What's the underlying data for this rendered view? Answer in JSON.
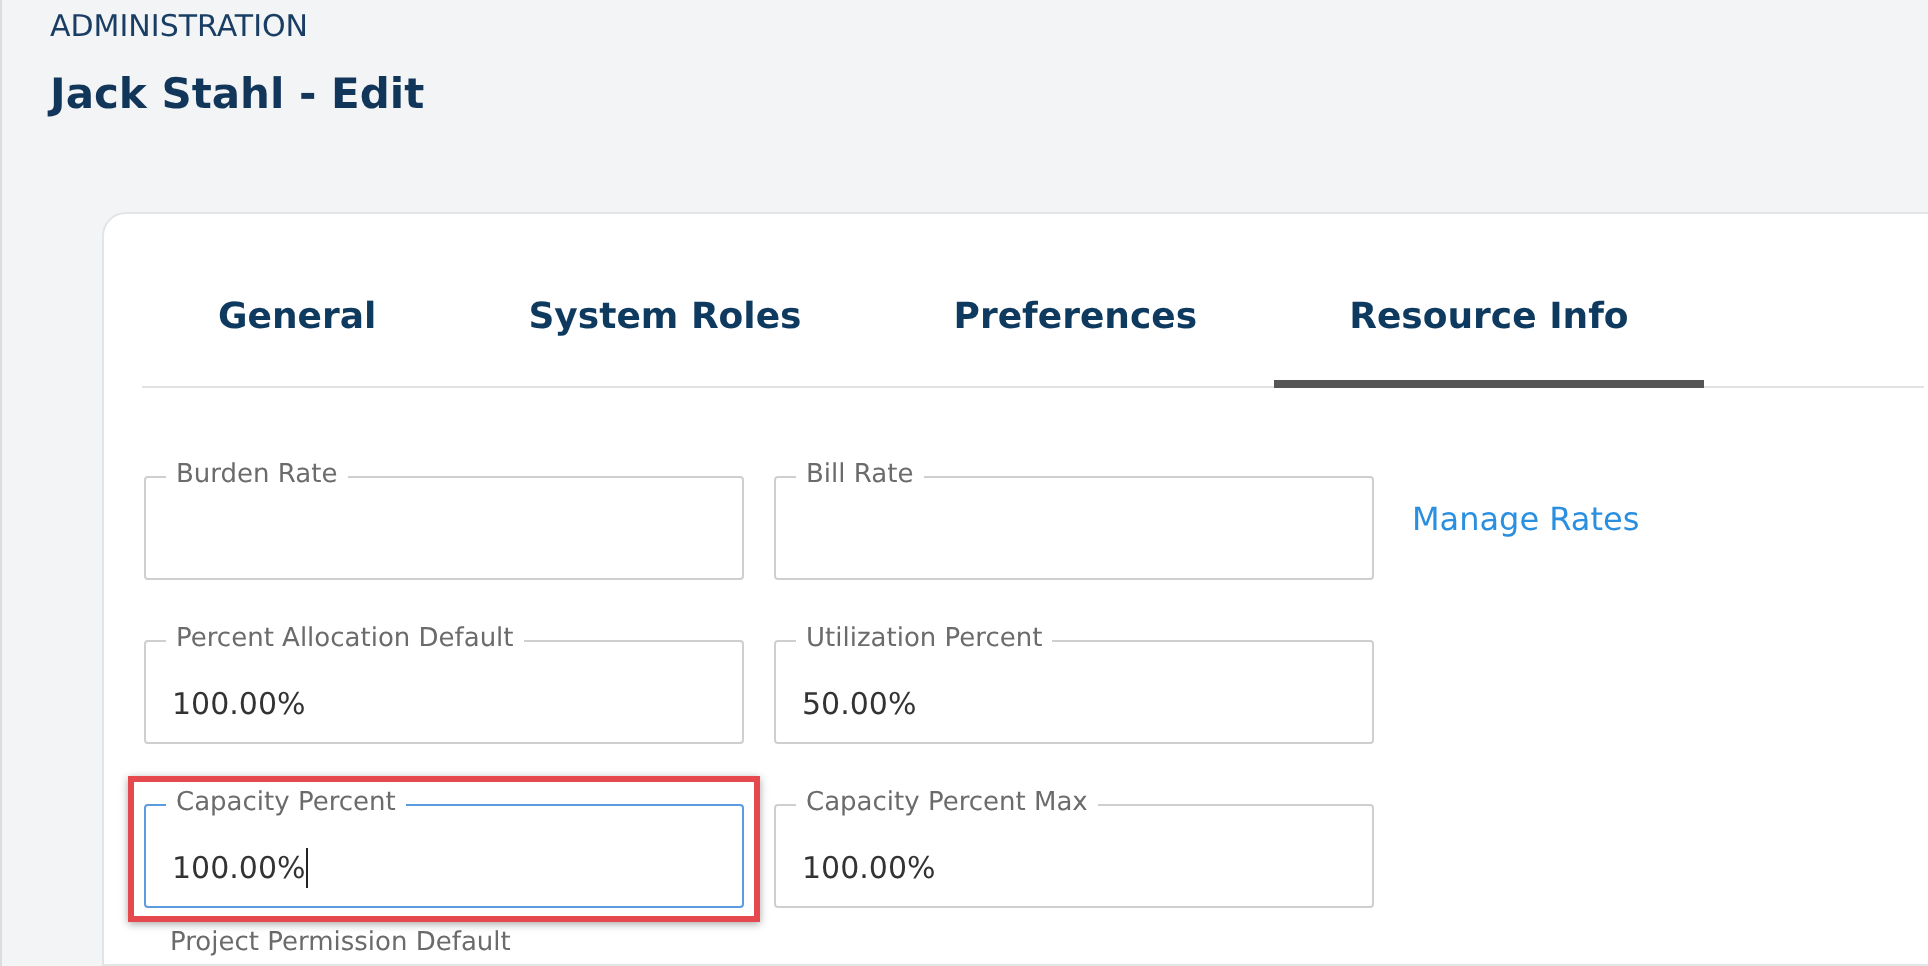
{
  "header": {
    "section": "ADMINISTRATION",
    "title": "Jack Stahl - Edit"
  },
  "tabs": [
    {
      "label": "General",
      "selected": false
    },
    {
      "label": "System Roles",
      "selected": false
    },
    {
      "label": "Preferences",
      "selected": false
    },
    {
      "label": "Resource Info",
      "selected": true
    }
  ],
  "form_rows": [
    [
      {
        "kind": "field",
        "label": "Burden Rate",
        "focused": false,
        "highlighted": false
      },
      {
        "kind": "field",
        "label": "Bill Rate",
        "focused": false,
        "highlighted": false
      },
      {
        "kind": "link",
        "label": "Manage Rates"
      }
    ],
    [
      {
        "kind": "field",
        "label": "Percent Allocation Default",
        "value": "100.00%",
        "focused": false,
        "highlighted": false
      },
      {
        "kind": "field",
        "label": "Utilization Percent",
        "value": "50.00%",
        "focused": false,
        "highlighted": false
      }
    ],
    [
      {
        "kind": "field",
        "label": "Capacity Percent",
        "value": "100.00%",
        "focused": true,
        "highlighted": true
      },
      {
        "kind": "field",
        "label": "Capacity Percent Max",
        "value": "100.00%",
        "focused": false,
        "highlighted": false
      }
    ]
  ],
  "next_field": {
    "label": "Project Permission Default"
  }
}
